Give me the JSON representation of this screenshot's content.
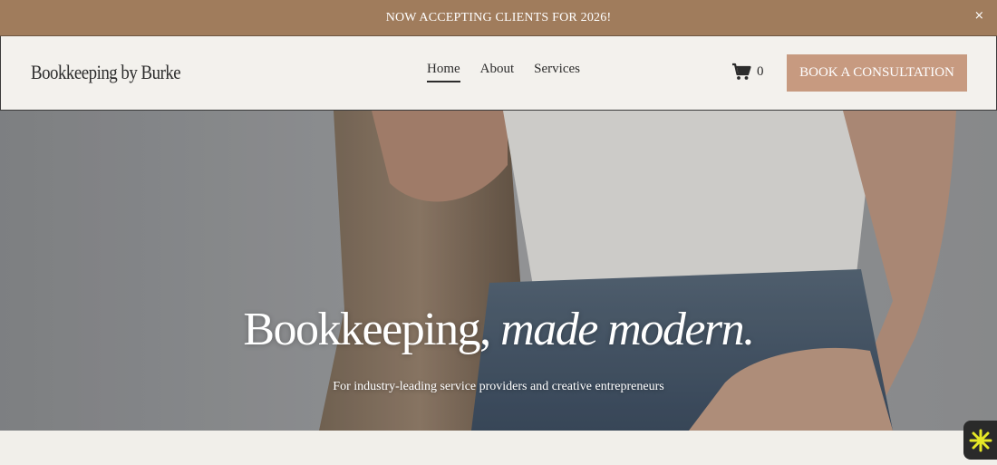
{
  "announcement": {
    "text": "NOW ACCEPTING CLIENTS FOR 2026!",
    "close_label": "×"
  },
  "header": {
    "logo": "Bookkeeping by Burke",
    "nav": [
      {
        "label": "Home",
        "active": true
      },
      {
        "label": "About",
        "active": false
      },
      {
        "label": "Services",
        "active": false
      }
    ],
    "cart": {
      "icon": "cart-icon",
      "count": "0"
    },
    "cta_label": "BOOK A CONSULTATION"
  },
  "hero": {
    "title_plain": "Bookkeeping,",
    "title_italic": "made modern.",
    "subtitle": "For industry-leading service providers and creative entrepreneurs"
  },
  "widget": {
    "icon": "sparkle-icon"
  },
  "colors": {
    "announcement_bg": "#a07c5c",
    "header_bg": "#f3f1ed",
    "cta_bg": "#c79a80",
    "page_bg": "#f1efea",
    "text_dark": "#2c2c2c",
    "widget_accent": "#e6e826"
  }
}
